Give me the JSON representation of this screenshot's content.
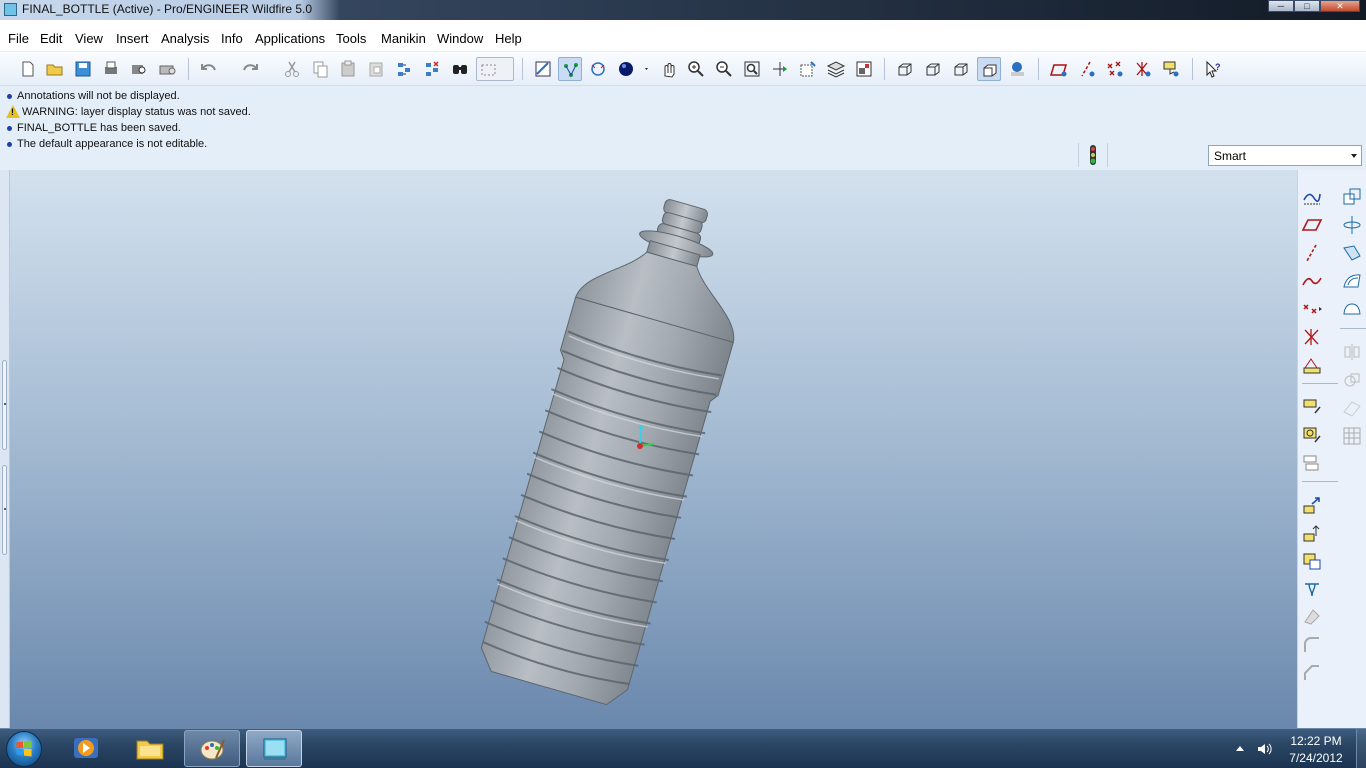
{
  "window": {
    "title": "FINAL_BOTTLE (Active) - Pro/ENGINEER Wildfire 5.0",
    "buttons": [
      "─",
      "□",
      "✕"
    ]
  },
  "menubar": {
    "items": [
      "File",
      "Edit",
      "View",
      "Insert",
      "Analysis",
      "Info",
      "Applications",
      "Tools",
      "Manikin",
      "Window",
      "Help"
    ]
  },
  "messages": [
    {
      "type": "info",
      "text": "Annotations will not be displayed."
    },
    {
      "type": "warning",
      "text": "WARNING: layer display status was not saved."
    },
    {
      "type": "info",
      "text": "FINAL_BOTTLE has been saved."
    },
    {
      "type": "info",
      "text": "The default appearance is not editable."
    }
  ],
  "filter": {
    "selected": "Smart"
  },
  "taskbar": {
    "time": "12:22 PM",
    "date": "7/24/2012"
  },
  "colors": {
    "accent": "#c9dcf3",
    "viewport_top": "#d3e1ee",
    "viewport_bottom": "#6a88ad",
    "model": "#9aa1a8"
  }
}
